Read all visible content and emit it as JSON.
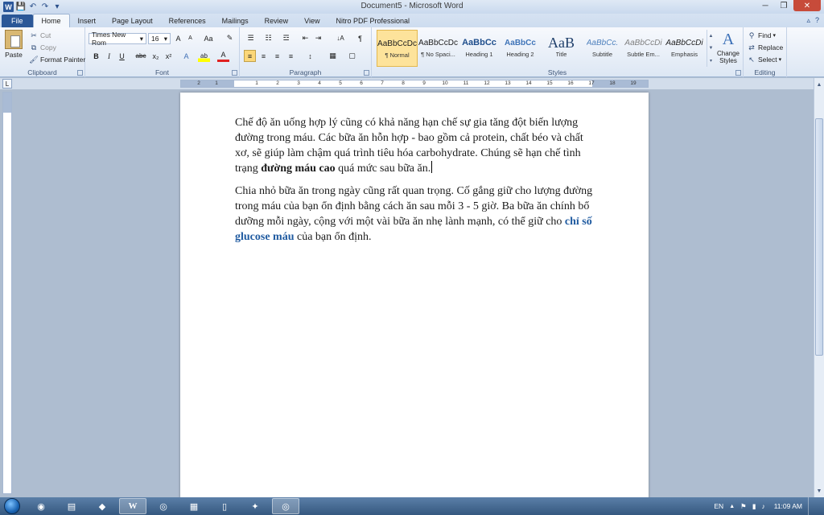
{
  "window": {
    "title": "Document5 - Microsoft Word",
    "min_glyph": "─",
    "max_glyph": "❐",
    "close_glyph": "✕"
  },
  "qat": {
    "word": "W",
    "save": "💾",
    "undo": "↶",
    "redo": "↷",
    "customize": "▾"
  },
  "tabs": [
    {
      "label": "File"
    },
    {
      "label": "Home"
    },
    {
      "label": "Insert"
    },
    {
      "label": "Page Layout"
    },
    {
      "label": "References"
    },
    {
      "label": "Mailings"
    },
    {
      "label": "Review"
    },
    {
      "label": "View"
    },
    {
      "label": "Nitro PDF Professional"
    }
  ],
  "tab_right": {
    "minimize": "▵",
    "help": "?"
  },
  "clipboard": {
    "label": "Clipboard",
    "paste": "Paste",
    "cut": "Cut",
    "copy": "Copy",
    "format_painter": "Format Painter"
  },
  "font": {
    "label": "Font",
    "name": "Times New Rom",
    "size": "16",
    "grow": "A",
    "shrink": "A",
    "change_case": "Aa",
    "clear": "✎",
    "bold": "B",
    "italic": "I",
    "underline": "U",
    "strike": "abc",
    "subscript": "x₂",
    "superscript": "x²",
    "effects": "A",
    "highlight": "ab",
    "color": "A"
  },
  "paragraph": {
    "label": "Paragraph",
    "bullets": "☰",
    "numbering": "☷",
    "multilevel": "☲",
    "decrease": "⇤",
    "increase": "⇥",
    "sort": "↓A",
    "show": "¶",
    "align_left": "≡",
    "center": "≡",
    "align_right": "≡",
    "justify": "≡",
    "spacing": "↕",
    "shading": "▦",
    "borders": "▢"
  },
  "styles": {
    "label": "Styles",
    "items": [
      {
        "sample": "AaBbCcDc",
        "name": "¶ Normal"
      },
      {
        "sample": "AaBbCcDc",
        "name": "¶ No Spaci..."
      },
      {
        "sample": "AaBbCc",
        "name": "Heading 1"
      },
      {
        "sample": "AaBbCc",
        "name": "Heading 2"
      },
      {
        "sample": "AaB",
        "name": "Title"
      },
      {
        "sample": "AaBbCc.",
        "name": "Subtitle"
      },
      {
        "sample": "AaBbCcDi",
        "name": "Subtle Em..."
      },
      {
        "sample": "AaBbCcDi",
        "name": "Emphasis"
      }
    ],
    "change_styles": "Change Styles",
    "change_styles_glyph": "A",
    "scroll_up": "▲",
    "scroll_down": "▼",
    "scroll_more": "▾"
  },
  "editing": {
    "label": "Editing",
    "find": "Find",
    "replace": "Replace",
    "select": "Select"
  },
  "ruler": {
    "corner_glyph": "L",
    "numbers": [
      "2",
      "1",
      "1",
      "2",
      "3",
      "4",
      "5",
      "6",
      "7",
      "8",
      "9",
      "10",
      "11",
      "12",
      "13",
      "14",
      "15",
      "16",
      "17",
      "18",
      "19"
    ]
  },
  "document": {
    "p1_part1": "Chế độ ăn uống hợp lý cũng có khả năng hạn chế sự gia tăng đột biến lượng đường trong máu. Các bữa ăn hỗn hợp - bao gồm cả protein, chất béo và chất xơ, sẽ giúp làm chậm quá trình tiêu hóa carbohydrate. Chúng sẽ hạn chế tình trạng ",
    "p1_bold": "đường máu cao",
    "p1_part2": " quá mức sau bữa ăn.",
    "p2_part1": "Chia nhỏ bữa ăn trong ngày cũng rất quan trọng. Cố gắng giữ cho lượng đường trong máu của bạn ổn định bằng cách ăn sau mỗi 3 - 5 giờ. Ba bữa ăn chính bổ dưỡng mỗi ngày, cộng với một vài bữa ăn nhẹ lành mạnh, có thể giữ cho ",
    "p2_link": "chỉ số glucose máu",
    "p2_part2": " của bạn ổn định."
  },
  "scrollbar": {
    "up": "▲",
    "down": "▼"
  },
  "taskbar": {
    "items": [
      {
        "glyph": "◉"
      },
      {
        "glyph": "▤"
      },
      {
        "glyph": "◆"
      },
      {
        "glyph": "W"
      },
      {
        "glyph": "◎"
      },
      {
        "glyph": "▦"
      },
      {
        "glyph": "▯"
      },
      {
        "glyph": "✦"
      },
      {
        "glyph": "◎"
      }
    ],
    "lang": "EN",
    "tray_up": "▲",
    "flag": "⚑",
    "signal": "▮",
    "volume": "♪",
    "clock": "11:09 AM"
  },
  "colors": {
    "file_tab": "#2b5797",
    "link_text": "#1f5aa0",
    "selected_style": "#fde39b"
  }
}
